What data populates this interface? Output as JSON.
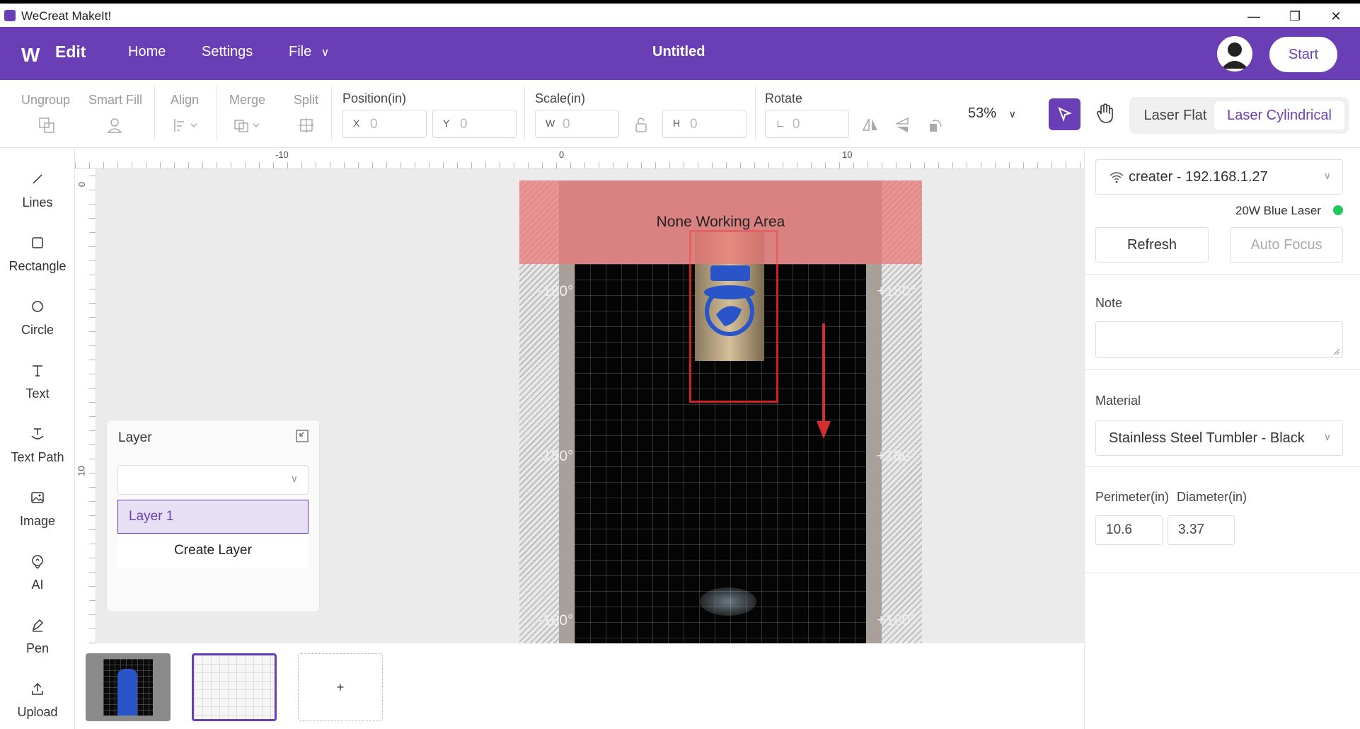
{
  "window": {
    "title": "WeCreat MakeIt!",
    "minimize": "—",
    "restore": "❐",
    "close": "✕"
  },
  "menubar": {
    "logo": "W",
    "mode": "Edit",
    "nav": [
      "Home",
      "Settings",
      "File"
    ],
    "file_chevron": "⌄",
    "doc_title": "Untitled",
    "start_label": "Start"
  },
  "toolbar": {
    "ungroup": "Ungroup",
    "smart_fill": "Smart Fill",
    "align": "Align",
    "merge": "Merge",
    "split": "Split",
    "position_label": "Position(in)",
    "pos_x_prefix": "X",
    "pos_x": "0",
    "pos_y_prefix": "Y",
    "pos_y": "0",
    "scale_label": "Scale(in)",
    "scale_w_prefix": "W",
    "scale_w": "0",
    "scale_h_prefix": "H",
    "scale_h": "0",
    "rotate_label": "Rotate",
    "rotate_value": "0",
    "zoom": "53%",
    "laser_flat": "Laser Flat",
    "laser_cylindrical": "Laser Cylindrical"
  },
  "tools": [
    {
      "label": "Lines",
      "icon": "line-icon"
    },
    {
      "label": "Rectangle",
      "icon": "rectangle-icon"
    },
    {
      "label": "Circle",
      "icon": "circle-icon"
    },
    {
      "label": "Text",
      "icon": "text-icon"
    },
    {
      "label": "Text Path",
      "icon": "text-path-icon"
    },
    {
      "label": "Image",
      "icon": "image-icon"
    },
    {
      "label": "AI",
      "icon": "ai-icon"
    },
    {
      "label": "Pen",
      "icon": "pen-icon"
    },
    {
      "label": "Upload",
      "icon": "upload-icon"
    }
  ],
  "ruler": {
    "top": [
      "-10",
      "0",
      "10"
    ],
    "left": [
      "0",
      "10"
    ]
  },
  "canvas": {
    "non_working_label": "None Working Area",
    "deg_left": "-180°",
    "deg_right": "+180°"
  },
  "layer_panel": {
    "title": "Layer",
    "select_value": "",
    "layers": [
      "Layer 1"
    ],
    "create_label": "Create Layer"
  },
  "thumbnails": {
    "add_label": "+"
  },
  "right_panel": {
    "device": "creater - 192.168.1.27",
    "laser": "20W Blue Laser",
    "status_color": "#22c55e",
    "refresh": "Refresh",
    "auto_focus": "Auto Focus",
    "note_label": "Note",
    "note_value": "",
    "material_label": "Material",
    "material_value": "Stainless Steel Tumbler - Black",
    "perimeter_label": "Perimeter(in)",
    "diameter_label": "Diameter(in)",
    "perimeter_value": "10.6",
    "diameter_value": "3.37"
  },
  "colors": {
    "accent": "#6a3fb5",
    "nwa": "#eb7878",
    "arrow": "#d32f2f"
  }
}
